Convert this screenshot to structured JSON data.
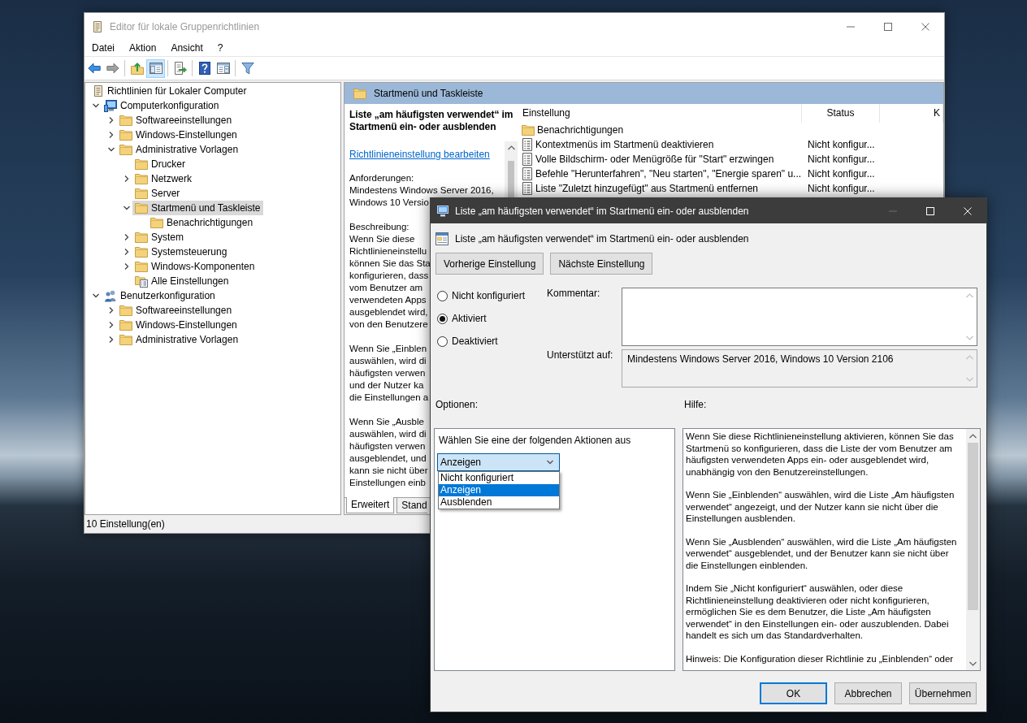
{
  "main_window": {
    "title": "Editor für lokale Gruppenrichtlinien",
    "active": false,
    "window_controls": [
      {
        "kind": "minimize",
        "disabled": false
      },
      {
        "kind": "maximize",
        "disabled": false
      },
      {
        "kind": "close",
        "disabled": false
      }
    ]
  },
  "menu": [
    "Datei",
    "Aktion",
    "Ansicht",
    "?"
  ],
  "toolbar": [
    {
      "buttons": [
        {
          "kind": "back",
          "pressed": false,
          "disabled": false
        },
        {
          "kind": "forward",
          "pressed": false,
          "disabled": true
        }
      ]
    },
    {
      "buttons": [
        {
          "kind": "up",
          "pressed": false,
          "disabled": false
        },
        {
          "kind": "tree",
          "pressed": true,
          "disabled": false
        }
      ]
    },
    {
      "buttons": [
        {
          "kind": "export",
          "pressed": false,
          "disabled": false
        }
      ]
    },
    {
      "buttons": [
        {
          "kind": "help",
          "pressed": false,
          "disabled": false
        },
        {
          "kind": "pane",
          "pressed": false,
          "disabled": false
        }
      ]
    },
    {
      "buttons": [
        {
          "kind": "filter",
          "pressed": false,
          "disabled": false
        }
      ]
    }
  ],
  "tree": [
    {
      "label": "Richtlinien für Lokaler Computer",
      "kind": "policy",
      "selected": false,
      "children": [
        {
          "label": "Computerkonfiguration",
          "kind": "computer",
          "expanded": true,
          "selected": false,
          "children": [
            {
              "label": "Softwareeinstellungen",
              "kind": "folder",
              "expanded": false,
              "selected": false
            },
            {
              "label": "Windows-Einstellungen",
              "kind": "folder",
              "expanded": false,
              "selected": false
            },
            {
              "label": "Administrative Vorlagen",
              "kind": "folder",
              "expanded": true,
              "selected": false,
              "children": [
                {
                  "label": "Drucker",
                  "kind": "folder",
                  "selected": false
                },
                {
                  "label": "Netzwerk",
                  "kind": "folder",
                  "expanded": false,
                  "selected": false
                },
                {
                  "label": "Server",
                  "kind": "folder",
                  "selected": false
                },
                {
                  "label": "Startmenü und Taskleiste",
                  "kind": "folder",
                  "expanded": true,
                  "selected": true,
                  "children": [
                    {
                      "label": "Benachrichtigungen",
                      "kind": "folder",
                      "selected": false
                    }
                  ]
                },
                {
                  "label": "System",
                  "kind": "folder",
                  "expanded": false,
                  "selected": false
                },
                {
                  "label": "Systemsteuerung",
                  "kind": "folder",
                  "expanded": false,
                  "selected": false
                },
                {
                  "label": "Windows-Komponenten",
                  "kind": "folder",
                  "expanded": false,
                  "selected": false
                },
                {
                  "label": "Alle Einstellungen",
                  "kind": "all-settings",
                  "selected": false
                }
              ]
            }
          ]
        },
        {
          "label": "Benutzerkonfiguration",
          "kind": "users",
          "expanded": true,
          "selected": false,
          "children": [
            {
              "label": "Softwareeinstellungen",
              "kind": "folder",
              "expanded": false,
              "selected": false
            },
            {
              "label": "Windows-Einstellungen",
              "kind": "folder",
              "expanded": false,
              "selected": false
            },
            {
              "label": "Administrative Vorlagen",
              "kind": "folder",
              "expanded": false,
              "selected": false
            }
          ]
        }
      ]
    }
  ],
  "pane_header": {
    "title": "Startmenü und Taskleiste"
  },
  "description": {
    "title": "Liste „am häufigsten verwendet“ im Startmenü ein- oder ausblenden",
    "link": "Richtlinieneinstellung bearbeiten",
    "sections": [
      {
        "lines": [
          "Anforderungen:",
          "Mindestens Windows Server 2016,",
          "Windows 10 Versio"
        ]
      },
      {
        "lines": [
          "Beschreibung:",
          "Wenn Sie diese",
          "Richtlinieneinstellu",
          "können Sie das Sta",
          "konfigurieren, dass",
          "vom Benutzer am",
          "verwendeten Apps",
          "ausgeblendet wird,",
          "von den Benutzere"
        ]
      },
      {
        "lines": [
          "Wenn Sie „Einblen",
          "auswählen, wird di",
          "häufigsten verwen",
          "und der Nutzer ka",
          "die Einstellungen a"
        ]
      },
      {
        "lines": [
          "Wenn Sie „Ausble",
          "auswählen, wird di",
          "häufigsten verwen",
          "ausgeblendet, und",
          "kann sie nicht über",
          "Einstellungen einb"
        ]
      }
    ]
  },
  "settings_table": {
    "columns": [
      "Einstellung",
      "Status",
      "K"
    ],
    "rows": [
      {
        "kind": "folder",
        "name": "Benachrichtigungen"
      },
      {
        "kind": "setting",
        "name": "Kontextmenüs im Startmenü deaktivieren",
        "status": "Nicht konfigur..."
      },
      {
        "kind": "setting",
        "name": "Volle Bildschirm- oder Menügröße für \"Start\" erzwingen",
        "status": "Nicht konfigur..."
      },
      {
        "kind": "setting",
        "name": "Befehle \"Herunterfahren\", \"Neu starten\", \"Energie sparen\" u...",
        "status": "Nicht konfigur..."
      },
      {
        "kind": "setting",
        "name": "Liste \"Zuletzt hinzugefügt\" aus Startmenü entfernen",
        "status": "Nicht konfigur..."
      }
    ]
  },
  "view_tabs": [
    {
      "label": "Erweitert",
      "selected": true
    },
    {
      "label": "Stand",
      "selected": false
    }
  ],
  "status_bar": "10 Einstellung(en)",
  "dialog": {
    "title": "Liste „am häufigsten verwendet“ im Startmenü ein- oder ausblenden",
    "window_controls": [
      {
        "kind": "minimize",
        "disabled": true
      },
      {
        "kind": "maximize",
        "disabled": false
      },
      {
        "kind": "close",
        "disabled": false
      }
    ],
    "heading": "Liste „am häufigsten verwendet“ im Startmenü ein- oder ausblenden",
    "nav_buttons": [
      "Vorherige Einstellung",
      "Nächste Einstellung"
    ],
    "states": [
      {
        "label": "Nicht konfiguriert",
        "selected": false
      },
      {
        "label": "Aktiviert",
        "selected": true
      },
      {
        "label": "Deaktiviert",
        "selected": false
      }
    ],
    "comment_label": "Kommentar:",
    "supported_label": "Unterstützt auf:",
    "supported_value": "Mindestens Windows Server 2016, Windows 10 Version 2106",
    "options_label": "Optionen:",
    "help_label": "Hilfe:",
    "options": {
      "prompt": "Wählen Sie eine der folgenden Aktionen aus",
      "select": {
        "value": "Anzeigen",
        "expanded": true,
        "choices": [
          {
            "label": "Nicht konfiguriert",
            "selected": false
          },
          {
            "label": "Anzeigen",
            "selected": true
          },
          {
            "label": "Ausblenden",
            "selected": false
          }
        ]
      }
    },
    "help": [
      "Wenn Sie diese Richtlinieneinstellung aktivieren, können Sie das Startmenü so konfigurieren, dass die Liste der vom Benutzer am häufigsten verwendeten Apps ein- oder ausgeblendet wird, unabhängig von den Benutzereinstellungen.",
      "Wenn Sie „Einblenden“ auswählen, wird die Liste „Am häufigsten verwendet“ angezeigt, und der Nutzer kann sie nicht über die Einstellungen ausblenden.",
      "Wenn Sie „Ausblenden“ auswählen, wird die Liste „Am häufigsten verwendet“ ausgeblendet, und der Benutzer kann sie nicht über die Einstellungen einblenden.",
      "Indem Sie „Nicht konfiguriert“ auswählen, oder diese Richtlinieneinstellung deaktivieren oder nicht konfigurieren, ermöglichen Sie es dem Benutzer, die Liste „Am häufigsten verwendet“ in den Einstellungen ein- oder auszublenden. Dabei handelt es sich um das Standardverhalten.",
      "Hinweis: Die Konfiguration dieser Richtlinie zu „Einblenden“ oder"
    ],
    "buttons": [
      {
        "label": "OK",
        "focused": true
      },
      {
        "label": "Abbrechen",
        "focused": false
      },
      {
        "label": "Übernehmen",
        "focused": false
      }
    ]
  }
}
